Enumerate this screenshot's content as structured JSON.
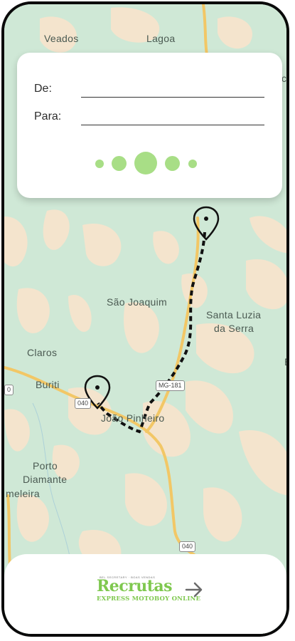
{
  "form": {
    "from_label": "De:",
    "to_label": "Para:",
    "from_value": "",
    "to_value": ""
  },
  "carousel": {
    "dot_count": 5,
    "active_index": 2
  },
  "map": {
    "places": {
      "veados": "Veados",
      "lagoa": "Lagoa",
      "sao_joaquim": "São Joaquim",
      "santa_luzia_1": "Santa Luzia",
      "santa_luzia_2": "da Serra",
      "claros": "Claros",
      "buriti": "Buriti",
      "joao_pinheiro": "João Pinheiro",
      "porto_diamante_1": "Porto",
      "porto_diamante_2": "Diamante",
      "meleira": "meleira",
      "edge_e": "E",
      "edge_ca": "ca"
    },
    "road_labels": {
      "mg181": "MG-181",
      "r040_top": "040",
      "r040_bottom": "040",
      "left_edge": "0"
    }
  },
  "brand": {
    "tagline": "BEL SECRETARY · BOAS VENDAS",
    "name": "Recrutas",
    "subtitle": "EXPRESS MOTOBOY ONLINE"
  },
  "colors": {
    "accent_green": "#a8de86",
    "brand_green": "#7fc84f",
    "map_green": "#cfe8d6",
    "map_sand": "#f5e6cf",
    "road_yellow": "#f2c766"
  }
}
